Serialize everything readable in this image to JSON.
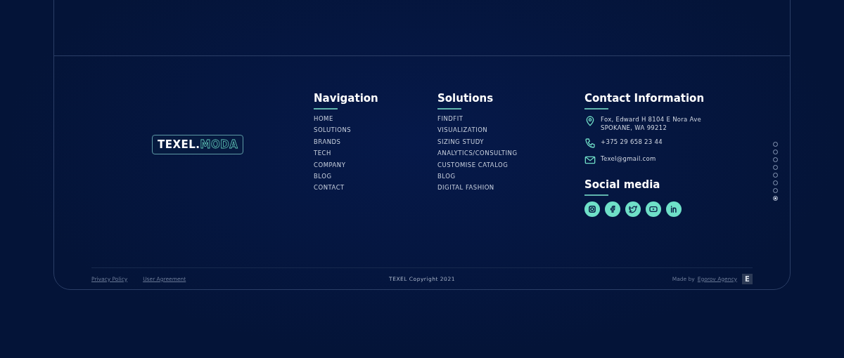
{
  "logo": {
    "primary": "TEXEL.",
    "accent": "MODA"
  },
  "columns": [
    {
      "title": "Navigation",
      "items": [
        "HOME",
        "SOLUTIONS",
        "BRANDS",
        "TECH",
        "COMPANY",
        "BLOG",
        "CONTACT"
      ]
    },
    {
      "title": "Solutions",
      "items": [
        "FINDFIT",
        "VISUALIZATION",
        "SIZING STUDY",
        "ANALYTICS/CONSULTING",
        "CUSTOMISE CATALOG",
        "BLOG",
        "DIGITAL FASHION"
      ]
    }
  ],
  "contact": {
    "title": "Contact Information",
    "items": [
      {
        "kind": "address",
        "lines": [
          "Fox, Edward H 8104 E Nora Ave",
          "SPOKANE, WA 99212"
        ]
      },
      {
        "kind": "phone",
        "lines": [
          "+375 29 658 23 44"
        ]
      },
      {
        "kind": "email",
        "lines": [
          "Texel@gmail.com"
        ]
      }
    ]
  },
  "social": {
    "title": "Social media",
    "items": [
      {
        "kind": "instagram"
      },
      {
        "kind": "facebook"
      },
      {
        "kind": "twitter"
      },
      {
        "kind": "youtube"
      },
      {
        "kind": "linkedin"
      }
    ]
  },
  "page_dots": [
    {
      "selected": false
    },
    {
      "selected": false
    },
    {
      "selected": false
    },
    {
      "selected": false
    },
    {
      "selected": false
    },
    {
      "selected": false
    },
    {
      "selected": false
    },
    {
      "selected": true
    }
  ],
  "bottom_bar": {
    "links": [
      "Privacy Policy",
      "User Agreement"
    ],
    "copyright": "TEXEL Copyright 2021",
    "made_by": "Made by",
    "agency": "Egorov Agency",
    "agency_badge": "E"
  }
}
